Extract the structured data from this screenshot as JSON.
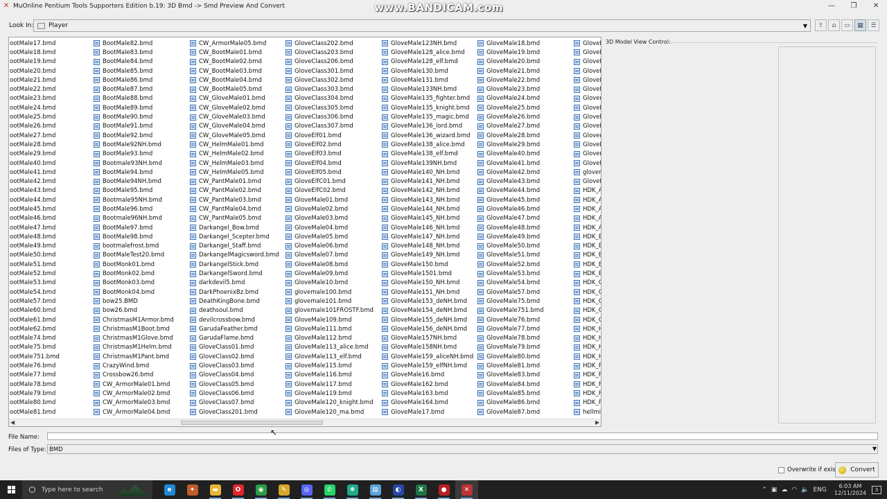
{
  "window": {
    "title": "MuOnline Pentium Tools Supporters Edition b.19: 3D Bmd -> Smd Preview And Convert",
    "watermark": "www.BANDICAM.com",
    "controls": [
      "minimize",
      "maximize",
      "close"
    ]
  },
  "lookin": {
    "label": "Look In:",
    "value": "Player",
    "view_buttons": [
      "up-folder-icon",
      "home-icon",
      "new-folder-icon",
      "list-view-icon",
      "details-view-icon"
    ]
  },
  "files": {
    "columns": [
      [
        "ootMale17.bmd",
        "ootMale18.bmd",
        "ootMale19.bmd",
        "ootMale20.bmd",
        "ootMale21.bmd",
        "ootMale22.bmd",
        "ootMale23.bmd",
        "ootMale24.bmd",
        "ootMale25.bmd",
        "ootMale26.bmd",
        "ootMale27.bmd",
        "ootMale28.bmd",
        "ootMale29.bmd",
        "ootMale40.bmd",
        "ootMale41.bmd",
        "ootMale42.bmd",
        "ootMale43.bmd",
        "ootMale44.bmd",
        "ootMale45.bmd",
        "ootMale46.bmd",
        "ootMale47.bmd",
        "ootMale48.bmd",
        "ootMale49.bmd",
        "ootMale50.bmd",
        "ootMale51.bmd",
        "ootMale52.bmd",
        "ootMale53.bmd",
        "ootMale54.bmd",
        "ootMale57.bmd",
        "ootMale60.bmd",
        "ootMale61.bmd",
        "ootMale62.bmd",
        "ootMale74.bmd",
        "ootMale75.bmd",
        "ootMale751.bmd",
        "ootMale76.bmd",
        "ootMale77.bmd",
        "ootMale78.bmd",
        "ootMale79.bmd",
        "ootMale80.bmd",
        "ootMale81.bmd"
      ],
      [
        "BootMale82.bmd",
        "BootMale83.bmd",
        "BootMale84.bmd",
        "BootMale85.bmd",
        "BootMale86.bmd",
        "BootMale87.bmd",
        "BootMale88.bmd",
        "BootMale89.bmd",
        "BootMale90.bmd",
        "BootMale91.bmd",
        "BootMale92.bmd",
        "BootMale92NH.bmd",
        "BootMale93.bmd",
        "Bootmale93NH.bmd",
        "BootMale94.bmd",
        "BootMale94NH.bmd",
        "BootMale95.bmd",
        "Bootmale95NH.bmd",
        "BootMale96.bmd",
        "Bootmale96NH.bmd",
        "BootMale97.bmd",
        "BootMale98.bmd",
        "bootmalefrost.bmd",
        "BootMaleTest20.bmd",
        "BootMonk01.bmd",
        "BootMonk02.bmd",
        "BootMonk03.bmd",
        "BootMonk04.bmd",
        "bow25.BMD",
        "bow26.bmd",
        "ChristmasM1Armor.bmd",
        "ChristmasM1Boot.bmd",
        "ChristmasM1Glove.bmd",
        "ChristmasM1Helm.bmd",
        "ChristmasM1Pant.bmd",
        "CrazyWind.bmd",
        "Crossbow26.bmd",
        "CW_ArmorMale01.bmd",
        "CW_ArmorMale02.bmd",
        "CW_ArmorMale03.bmd",
        "CW_ArmorMale04.bmd"
      ],
      [
        "CW_ArmorMale05.bmd",
        "CW_BootMale01.bmd",
        "CW_BootMale02.bmd",
        "CW_BootMale03.bmd",
        "CW_BootMale04.bmd",
        "CW_BootMale05.bmd",
        "CW_GloveMale01.bmd",
        "CW_GloveMale02.bmd",
        "CW_GloveMale03.bmd",
        "CW_GloveMale04.bmd",
        "CW_GloveMale05.bmd",
        "CW_HelmMale01.bmd",
        "CW_HelmMale02.bmd",
        "CW_HelmMale03.bmd",
        "CW_HelmMale05.bmd",
        "CW_PantMale01.bmd",
        "CW_PantMale02.bmd",
        "CW_PantMale03.bmd",
        "CW_PantMale04.bmd",
        "CW_PantMale05.bmd",
        "Darkangel_Bow.bmd",
        "Darkangel_Scepter.bmd",
        "Darkangel_Staff.bmd",
        "DarkangelMagicsword.bmd",
        "DarkangelStick.bmd",
        "DarkangelSword.bmd",
        "darkdevil5.bmd",
        "DarkPhoenixBz.bmd",
        "DeathKingBone.bmd",
        "deathsoul.bmd",
        "devilcrossbow.bmd",
        "GarudaFeather.bmd",
        "GarudaFlame.bmd",
        "GloveClass01.bmd",
        "GloveClass02.bmd",
        "GloveClass03.bmd",
        "GloveClass04.bmd",
        "GloveClass05.bmd",
        "GloveClass06.bmd",
        "GloveClass07.bmd",
        "GloveClass201.bmd"
      ],
      [
        "GloveClass202.bmd",
        "GloveClass203.bmd",
        "GloveClass206.bmd",
        "GloveClass301.bmd",
        "GloveClass302.bmd",
        "GloveClass303.bmd",
        "GloveClass304.bmd",
        "GloveClass305.bmd",
        "GloveClass306.bmd",
        "GloveClass307.bmd",
        "GloveElf01.bmd",
        "GloveElf02.bmd",
        "GloveElf03.bmd",
        "GloveElf04.bmd",
        "GloveElf05.bmd",
        "GloveElfC01.bmd",
        "GloveElfC02.bmd",
        "GloveMale01.bmd",
        "GloveMale02.bmd",
        "GloveMale03.bmd",
        "GloveMale04.bmd",
        "GloveMale05.bmd",
        "GloveMale06.bmd",
        "GloveMale07.bmd",
        "GloveMale08.bmd",
        "GloveMale09.bmd",
        "GloveMale10.bmd",
        "glovemale100.bmd",
        "glovemale101.bmd",
        "glovemale101FROSTF.bmd",
        "GloveMale109.bmd",
        "GloveMale111.bmd",
        "GloveMale112.bmd",
        "GloveMale113_alice.bmd",
        "GloveMale113_elf.bmd",
        "GloveMale115.bmd",
        "GloveMale116.bmd",
        "GloveMale117.bmd",
        "GloveMale119.bmd",
        "GloveMale120_knight.bmd",
        "GloveMale120_ma.bmd"
      ],
      [
        "GloveMale123NH.bmd",
        "GloveMale128_alice.bmd",
        "GloveMale128_elf.bmd",
        "GloveMale130.bmd",
        "GloveMale131.bmd",
        "GloveMale133NH.bmd",
        "GloveMale135_fighter.bmd",
        "GloveMale135_knight.bmd",
        "GloveMale135_magic.bmd",
        "GloveMale136_lord.bmd",
        "GloveMale136_wizard.bmd",
        "GloveMale138_alice.bmd",
        "GloveMale138_elf.bmd",
        "GloveMale139NH.bmd",
        "GloveMale140_NH.bmd",
        "GloveMale141_NH.bmd",
        "GloveMale142_NH.bmd",
        "GloveMale143_NH.bmd",
        "GloveMale144_NH.bmd",
        "GloveMale145_NH.bmd",
        "GloveMale146_NH.bmd",
        "GloveMale147_NH.bmd",
        "GloveMale148_NH.bmd",
        "GloveMale149_NH.bmd",
        "GloveMale150.bmd",
        "GloveMale1501.bmd",
        "GloveMale150_NH.bmd",
        "GloveMale151_NH.bmd",
        "GloveMale153_deNH.bmd",
        "GloveMale154_deNH.bmd",
        "GloveMale155_deNH.bmd",
        "GloveMale156_deNH.bmd",
        "GloveMale157NH.bmd",
        "GloveMale158NH.bmd",
        "GloveMale159_aliceNH.bmd",
        "GloveMale159_elfNH.bmd",
        "GloveMale16.bmd",
        "GloveMale162.bmd",
        "GloveMale163.bmd",
        "GloveMale164.bmd",
        "GloveMale17.bmd"
      ],
      [
        "GloveMale18.bmd",
        "GloveMale19.bmd",
        "GloveMale20.bmd",
        "GloveMale21.bmd",
        "GloveMale22.bmd",
        "GloveMale23.bmd",
        "GloveMale24.bmd",
        "GloveMale25.bmd",
        "GloveMale26.bmd",
        "GloveMale27.bmd",
        "GloveMale28.bmd",
        "GloveMale29.bmd",
        "GloveMale40.bmd",
        "GloveMale41.bmd",
        "GloveMale42.bmd",
        "GloveMale43.bmd",
        "GloveMale44.bmd",
        "GloveMale45.bmd",
        "GloveMale46.bmd",
        "GloveMale47.bmd",
        "GloveMale48.bmd",
        "GloveMale49.bmd",
        "GloveMale50.bmd",
        "GloveMale51.bmd",
        "GloveMale52.bmd",
        "GloveMale53.bmd",
        "GloveMale54.bmd",
        "GloveMale57.bmd",
        "GloveMale75.bmd",
        "GloveMale751.bmd",
        "GloveMale76.bmd",
        "GloveMale77.bmd",
        "GloveMale78.bmd",
        "GloveMale79.bmd",
        "GloveMale80.bmd",
        "GloveMale81.bmd",
        "GloveMale83.bmd",
        "GloveMale84.bmd",
        "GloveMale85.bmd",
        "GloveMale86.bmd",
        "GloveMale87.bmd"
      ],
      [
        "GloveM",
        "GloveM",
        "GloveM",
        "GloveM",
        "GloveM",
        "GloveM",
        "Glovem",
        "GloveM",
        "GloveM",
        "GloveM",
        "Glovem",
        "GloveM",
        "Glovem",
        "GloveM",
        "glovem",
        "GloveM",
        "HDK_A",
        "HDK_A",
        "HDK_A",
        "HDK_A",
        "HDK_A",
        "HDK_B",
        "HDK_B",
        "HDK_B",
        "HDK_B",
        "HDK_B",
        "HDK_G",
        "HDK_G",
        "HDK_G",
        "HDK_G",
        "HDK_G",
        "HDK_H",
        "HDK_H",
        "HDK_H",
        "HDK_H",
        "HDK_P",
        "HDK_P",
        "HDK_P",
        "HDK_P",
        "HDK_P",
        "hellmin"
      ]
    ]
  },
  "view_panel": {
    "label": "3D Model View Control:"
  },
  "filename": {
    "label": "File Name:",
    "value": ""
  },
  "filetype": {
    "label": "Files of Type:",
    "value": "BMD"
  },
  "overwrite": {
    "label": "Overwrite if exist",
    "checked": false
  },
  "convert": {
    "label": "Convert"
  },
  "taskbar": {
    "search_placeholder": "Type here to search",
    "apps": [
      {
        "name": "edge-icon",
        "color": "#1f8ad2",
        "glyph": "e"
      },
      {
        "name": "settings-gear-icon",
        "color": "#c15b2a",
        "glyph": "✦"
      },
      {
        "name": "file-explorer-icon",
        "color": "#e7b637",
        "glyph": "▬"
      },
      {
        "name": "opera-icon",
        "color": "#e0262b",
        "glyph": "O"
      },
      {
        "name": "chrome-icon",
        "color": "#2c9d46",
        "glyph": "◉"
      },
      {
        "name": "tool-icon",
        "color": "#d9a52a",
        "glyph": "✎"
      },
      {
        "name": "discord-icon",
        "color": "#5865f2",
        "glyph": "◎"
      },
      {
        "name": "whatsapp-icon",
        "color": "#25d366",
        "glyph": "✆"
      },
      {
        "name": "app-icon",
        "color": "#1eaa8a",
        "glyph": "❋"
      },
      {
        "name": "notepad-icon",
        "color": "#5ba3d8",
        "glyph": "▤"
      },
      {
        "name": "app2-icon",
        "color": "#2746a6",
        "glyph": "◐"
      },
      {
        "name": "excel-icon",
        "color": "#1f7244",
        "glyph": "X"
      },
      {
        "name": "bandicam-icon",
        "color": "#b82020",
        "glyph": "●"
      },
      {
        "name": "pentium-tools-icon",
        "color": "#b33",
        "glyph": "✕"
      }
    ],
    "tray": {
      "language": "ENG",
      "time": "6:03 AM",
      "date": "12/11/2024",
      "notification_count": "3"
    }
  }
}
